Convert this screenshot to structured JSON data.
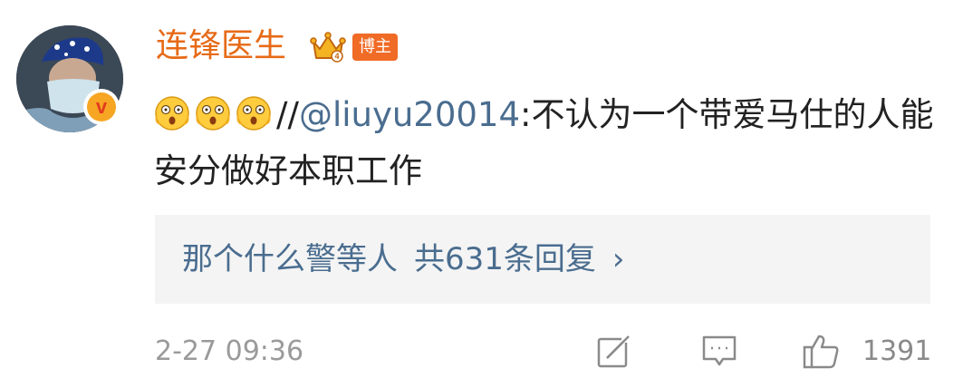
{
  "user": {
    "name": "连锋医生",
    "host_tag": "博主"
  },
  "comment": {
    "separator": "//",
    "mention": "@liuyu20014",
    "text": ":不认为一个带爱马仕的人能安分做好本职工作",
    "emoji_count": 3
  },
  "replies": {
    "names": "那个什么警等人",
    "count_text": "共631条回复",
    "chevron": "›"
  },
  "footer": {
    "time": "2-27 09:36",
    "like_count": "1391"
  },
  "colors": {
    "username": "#e76a17",
    "host_tag": "#f06b26",
    "link": "#4a6d8f",
    "muted": "#9a9a9a"
  }
}
